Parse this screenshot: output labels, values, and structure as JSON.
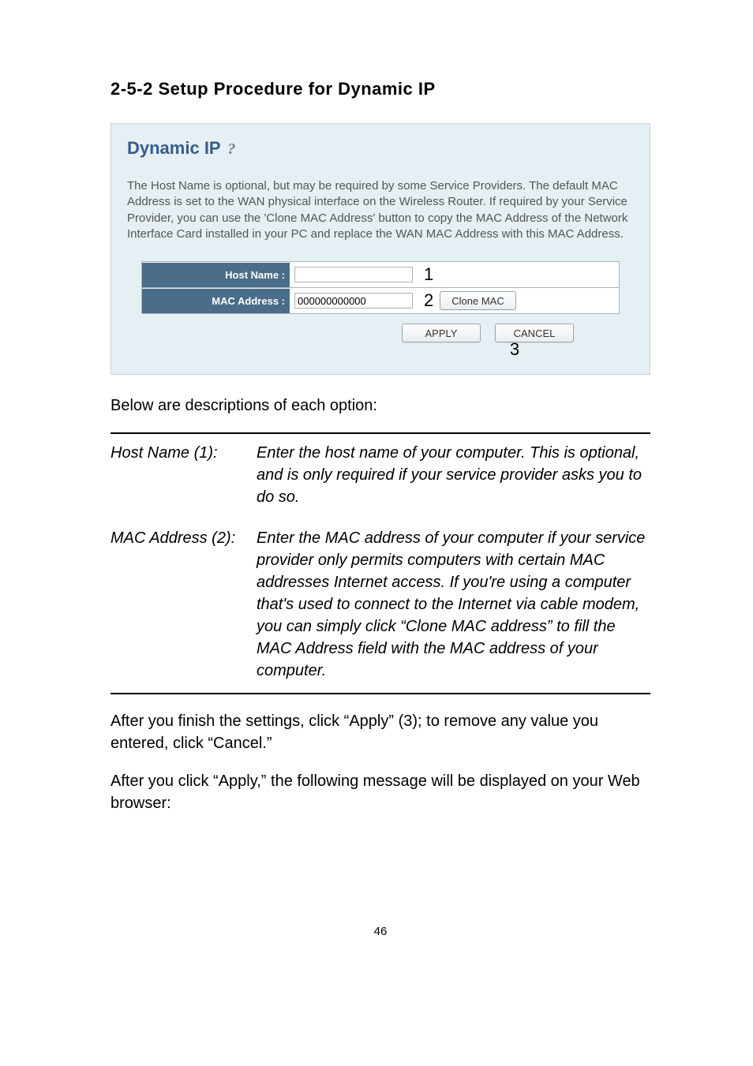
{
  "heading": "2-5-2 Setup Procedure for Dynamic IP",
  "panel": {
    "title": "Dynamic IP",
    "description": "The Host Name is optional, but may be required by some Service Providers. The default MAC Address is set to the WAN physical interface on the Wireless Router. If required by your Service Provider, you can use the 'Clone MAC Address' button to copy the MAC Address of the Network Interface Card installed in your PC and replace the WAN MAC Address with this MAC Address.",
    "host_name_label": "Host Name :",
    "host_name_value": "",
    "mac_label": "MAC Address :",
    "mac_value": "000000000000",
    "clone_btn": "Clone MAC",
    "apply_btn": "APPLY",
    "cancel_btn": "CANCEL",
    "ann": {
      "one": "1",
      "two": "2",
      "three": "3"
    }
  },
  "below_label": "Below are descriptions of each option:",
  "descriptions": {
    "r1term": "Host Name (1):",
    "r1def": "Enter the host name of your computer. This is optional, and is only required if your service provider asks you to do so.",
    "r2term": "MAC Address (2):",
    "r2def": "Enter the MAC address of your computer if your service provider only permits computers with certain MAC addresses Internet access. If you're using a computer that's used to connect to the Internet via cable modem, you can simply click “Clone MAC address” to fill the MAC Address field with the MAC address of your computer."
  },
  "after1": "After you finish the settings, click “Apply” (3); to remove any value you entered, click “Cancel.”",
  "after2": "After you click “Apply,” the following message will be displayed on your Web browser:",
  "page_number": "46"
}
